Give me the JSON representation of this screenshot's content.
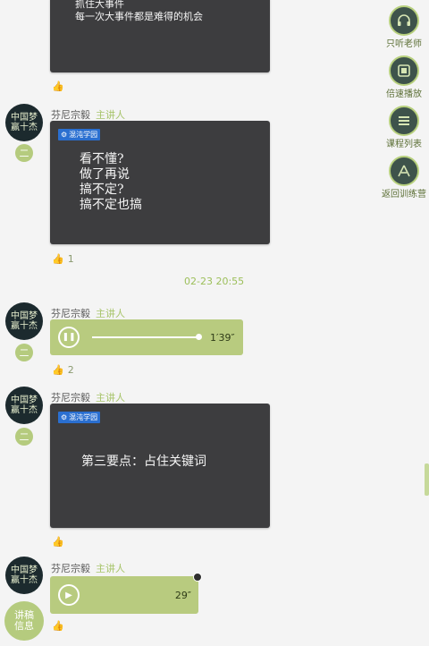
{
  "sidebar": {
    "items": [
      {
        "label": "只听老师",
        "icon": "headphones-icon"
      },
      {
        "label": "倍速播放",
        "icon": "speed-icon"
      },
      {
        "label": "课程列表",
        "icon": "list-icon"
      },
      {
        "label": "返回训练营",
        "icon": "return-icon"
      }
    ]
  },
  "messages": {
    "top_card": {
      "line1": "抓住大事件",
      "line2": "每一次大事件都是难得的机会"
    },
    "msg1": {
      "author": "芬尼宗毅",
      "role": "主讲人",
      "badge": "二",
      "avatar_text": "中国梦 赢十杰",
      "brand": "混沌学园",
      "lines": [
        "看不懂?",
        "做了再说",
        "搞不定?",
        "搞不定也搞"
      ],
      "likes": "1"
    },
    "timestamp": "02-23 20:55",
    "msg2": {
      "author": "芬尼宗毅",
      "role": "主讲人",
      "badge": "二",
      "avatar_text": "中国梦 赢十杰",
      "duration": "1′39″",
      "likes": "2"
    },
    "msg3": {
      "author": "芬尼宗毅",
      "role": "主讲人",
      "badge": "二",
      "avatar_text": "中国梦 赢十杰",
      "brand": "混沌学园",
      "title": "第三要点：占住关键词"
    },
    "msg4": {
      "author": "芬尼宗毅",
      "role": "主讲人",
      "avatar_text": "中国梦 赢十杰",
      "duration": "29″"
    },
    "float_button": {
      "label": "讲稿信息"
    }
  },
  "colors": {
    "accent": "#b5cb7e",
    "card": "#3d3d3f",
    "sidebar_button": "#3e534b"
  }
}
